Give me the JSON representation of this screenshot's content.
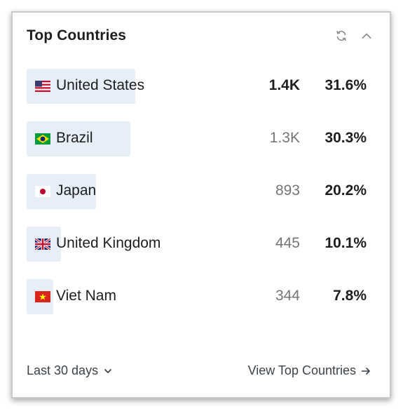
{
  "card": {
    "title": "Top Countries",
    "header_icons": [
      "refresh-icon",
      "chevron-up-icon"
    ]
  },
  "countries": [
    {
      "name": "United States",
      "value": "1.4K",
      "percent": "31.6%",
      "share": 0.316,
      "value_emphasized": true,
      "flag": "us-flag-icon"
    },
    {
      "name": "Brazil",
      "value": "1.3K",
      "percent": "30.3%",
      "share": 0.303,
      "value_emphasized": false,
      "flag": "brazil-flag-icon"
    },
    {
      "name": "Japan",
      "value": "893",
      "percent": "20.2%",
      "share": 0.202,
      "value_emphasized": false,
      "flag": "japan-flag-icon"
    },
    {
      "name": "United Kingdom",
      "value": "445",
      "percent": "10.1%",
      "share": 0.101,
      "value_emphasized": false,
      "flag": "uk-flag-icon"
    },
    {
      "name": "Viet Nam",
      "value": "344",
      "percent": "7.8%",
      "share": 0.078,
      "value_emphasized": false,
      "flag": "vietnam-flag-icon"
    }
  ],
  "footer": {
    "period_label": "Last 30 days",
    "period_icon": "chevron-down-icon",
    "link_label": "View Top Countries",
    "link_icon": "arrow-right-icon"
  },
  "colors": {
    "bar": "#e6eef8",
    "text": "#1e1e1e",
    "muted_value": "#757575",
    "footer_text": "#3c434a"
  }
}
